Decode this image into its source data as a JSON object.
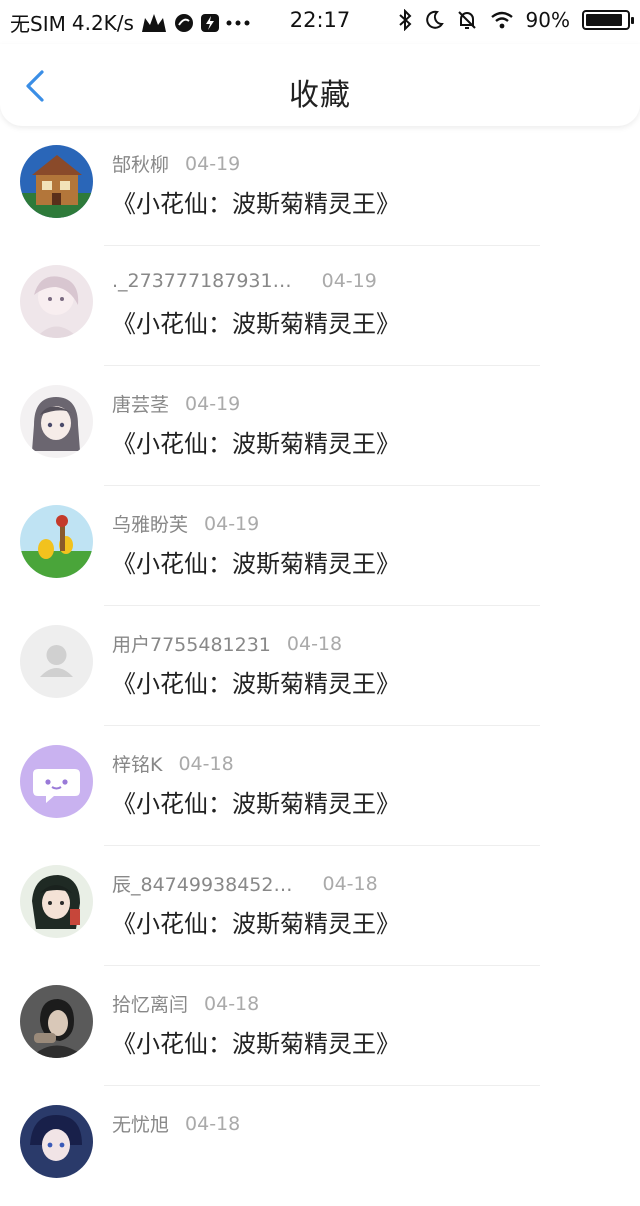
{
  "status_bar": {
    "carrier": "无SIM",
    "speed": "4.2K/s",
    "time": "22:17",
    "battery": "90%",
    "battery_level": 0.9
  },
  "nav": {
    "title": "收藏"
  },
  "items": [
    {
      "name": "郜秋柳",
      "date": "04-19",
      "title": "《小花仙：波斯菊精灵王》"
    },
    {
      "name": "._273777187931…",
      "date": "04-19",
      "title": "《小花仙：波斯菊精灵王》"
    },
    {
      "name": "唐芸茎",
      "date": "04-19",
      "title": "《小花仙：波斯菊精灵王》"
    },
    {
      "name": "乌雅盼芙",
      "date": "04-19",
      "title": "《小花仙：波斯菊精灵王》"
    },
    {
      "name": "用户7755481231",
      "date": "04-18",
      "title": "《小花仙：波斯菊精灵王》"
    },
    {
      "name": "梓铭K",
      "date": "04-18",
      "title": "《小花仙：波斯菊精灵王》"
    },
    {
      "name": "辰_84749938452…",
      "date": "04-18",
      "title": "《小花仙：波斯菊精灵王》"
    },
    {
      "name": "拾忆离闫",
      "date": "04-18",
      "title": "《小花仙：波斯菊精灵王》"
    },
    {
      "name": "无忧旭",
      "date": "04-18",
      "title": ""
    }
  ],
  "colors": {
    "accent": "#3a8ee6",
    "muted_text": "#888888"
  }
}
